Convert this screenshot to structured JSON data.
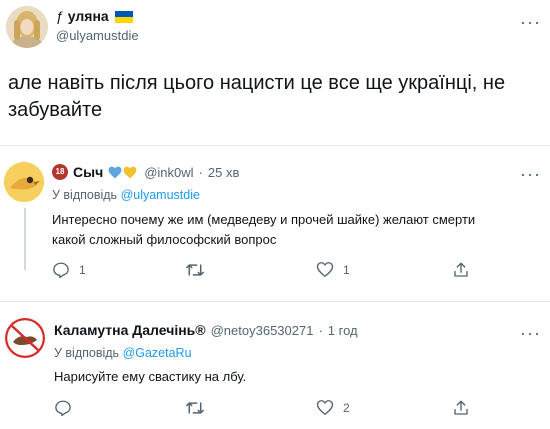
{
  "main_tweet": {
    "author_glyph": "ƒ",
    "author_name": "уляна",
    "handle": "@ulyamustdie",
    "text": "але навіть після цього нацисти це все ще українці, не забувайте",
    "flag_colors": [
      "#0057b7",
      "#ffd700"
    ]
  },
  "reply1": {
    "badge": "18",
    "author_name": "Сыч",
    "handle": "@ink0wl",
    "separator": "·",
    "time": "25 хв",
    "reply_prefix": "У відповідь",
    "reply_target": "@ulyamustdie",
    "text_line1": "Интересно почему же им (медведеву и прочей шайке) желают смерти",
    "text_line2": "какой сложный философский вопрос",
    "reply_count": "1",
    "like_count": "1",
    "heart_colors": [
      "#5ca5e0",
      "#f2c12e"
    ]
  },
  "reply2": {
    "author_name": "Каламутна Далечінь®",
    "handle": "@netoy36530271",
    "separator": "·",
    "time": "1 год",
    "reply_prefix": "У відповідь",
    "reply_target": "@GazetaRu",
    "text": "Нарисуйте ему свастику на лбу.",
    "like_count": "2"
  },
  "colors": {
    "link": "#1d9bf0",
    "secondary_text": "#536471",
    "text": "#0f1419",
    "divider": "#e6ecf0"
  },
  "icons": [
    "more-icon",
    "reply-icon",
    "retweet-icon",
    "like-icon",
    "share-icon",
    "heart-icon",
    "flag-icon"
  ]
}
